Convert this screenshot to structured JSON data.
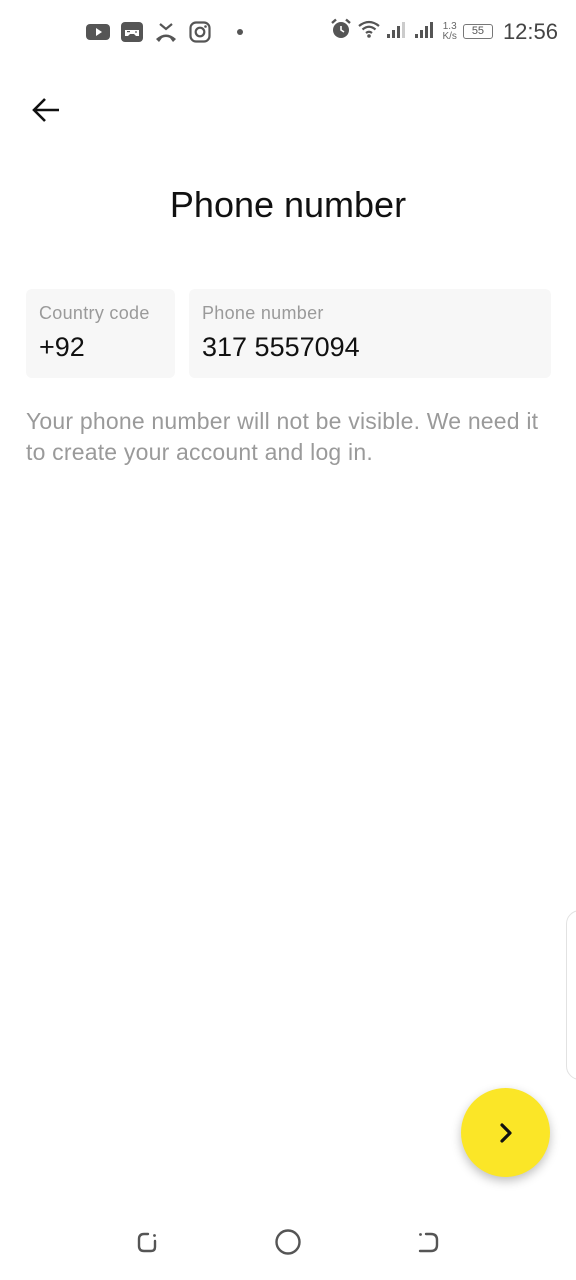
{
  "status_bar": {
    "left_icons": [
      "youtube-icon",
      "game-controller-icon",
      "missed-call-icon",
      "instagram-icon",
      "notification-dot-icon"
    ],
    "right_icons": [
      "alarm-icon",
      "wifi-icon",
      "signal-sim1-icon",
      "signal-sim2-icon"
    ],
    "net_speed_value": "1.3",
    "net_speed_unit": "K/s",
    "battery_level": "55",
    "time": "12:56"
  },
  "header": {
    "back_icon": "arrow-left-icon",
    "title": "Phone number"
  },
  "form": {
    "country_code": {
      "label": "Country code",
      "value": "+92"
    },
    "phone_number": {
      "label": "Phone number",
      "value": "317 5557094"
    },
    "hint": "Your phone number will not be visible. We need it to create your account and log in."
  },
  "next_button": {
    "icon": "chevron-right-icon",
    "color": "#fbe627"
  },
  "nav_bar": {
    "buttons": [
      "recents-icon",
      "home-icon",
      "back-icon"
    ]
  }
}
